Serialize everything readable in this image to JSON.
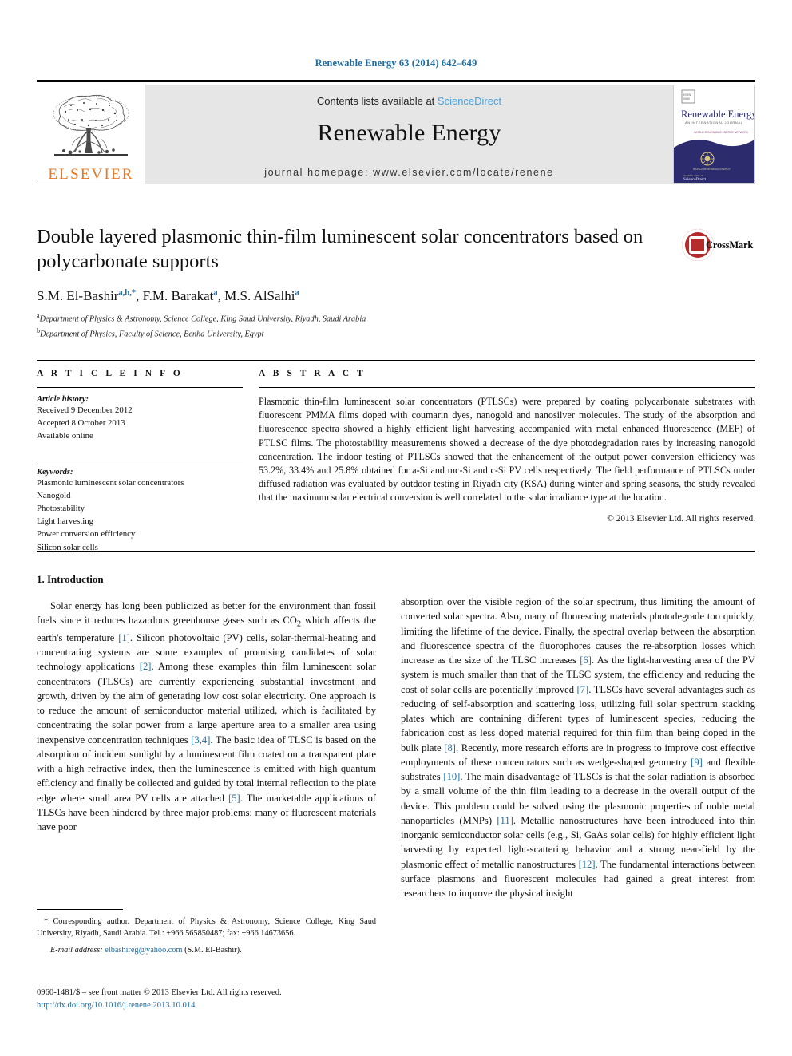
{
  "running_head": "Renewable Energy 63 (2014) 642–649",
  "masthead": {
    "contents_prefix": "Contents lists available at ",
    "sciencedirect": "ScienceDirect",
    "journal_title": "Renewable Energy",
    "homepage": "journal homepage: www.elsevier.com/locate/renene",
    "publisher_name": "ELSEVIER",
    "cover": {
      "title": "Renewable Energy",
      "subtitle": "AN INTERNATIONAL JOURNAL",
      "footer": "Elsevier"
    }
  },
  "article": {
    "title": "Double layered plasmonic thin-film luminescent solar concentrators based on polycarbonate supports",
    "authors": [
      {
        "name": "S.M. El-Bashir",
        "marks": "a,b,*"
      },
      {
        "name": "F.M. Barakat",
        "marks": "a"
      },
      {
        "name": "M.S. AlSalhi",
        "marks": "a"
      }
    ],
    "affiliations": [
      {
        "mark": "a",
        "text": "Department of Physics & Astronomy, Science College, King Saud University, Riyadh, Saudi Arabia"
      },
      {
        "mark": "b",
        "text": "Department of Physics, Faculty of Science, Benha University, Egypt"
      }
    ],
    "crossmark_label": "CrossMark"
  },
  "info": {
    "heading": "A R T I C L E   I N F O",
    "history_label": "Article history:",
    "history": [
      "Received 9 December 2012",
      "Accepted 8 October 2013",
      "Available online"
    ],
    "keywords_label": "Keywords:",
    "keywords": [
      "Plasmonic luminescent solar concentrators",
      "Nanogold",
      "Photostability",
      "Light harvesting",
      "Power conversion efficiency",
      "Silicon solar cells"
    ]
  },
  "abstract": {
    "heading": "A B S T R A C T",
    "text": "Plasmonic thin-film luminescent solar concentrators (PTLSCs) were prepared by coating polycarbonate substrates with fluorescent PMMA films doped with coumarin dyes, nanogold and nanosilver molecules. The study of the absorption and fluorescence spectra showed a highly efficient light harvesting accompanied with metal enhanced fluorescence (MEF) of PTLSC films. The photostability measurements showed a decrease of the dye photodegradation rates by increasing nanogold concentration. The indoor testing of PTLSCs showed that the enhancement of the output power conversion efficiency was 53.2%, 33.4% and 25.8% obtained for a-Si and mc-Si and c-Si PV cells respectively. The field performance of PTLSCs under diffused radiation was evaluated by outdoor testing in Riyadh city (KSA) during winter and spring seasons, the study revealed that the maximum solar electrical conversion is well correlated to the solar irradiance type at the location.",
    "copyright": "© 2013 Elsevier Ltd. All rights reserved."
  },
  "body": {
    "section_number_title": "1. Introduction",
    "left_paragraph_html": "Solar energy has long been publicized as better for the environment than fossil fuels since it reduces hazardous greenhouse gases such as CO<sub>2</sub> which affects the earth's temperature <span class=\"ref\">[1]</span>. Silicon photovoltaic (PV) cells, solar-thermal-heating and concentrating systems are some examples of promising candidates of solar technology applications <span class=\"ref\">[2]</span>. Among these examples thin film luminescent solar concentrators (TLSCs) are currently experiencing substantial investment and growth, driven by the aim of generating low cost solar electricity. One approach is to reduce the amount of semiconductor material utilized, which is facilitated by concentrating the solar power from a large aperture area to a smaller area using inexpensive concentration techniques <span class=\"ref\">[3,4]</span>. The basic idea of TLSC is based on the absorption of incident sunlight by a luminescent film coated on a transparent plate with a high refractive index, then the luminescence is emitted with high quantum efficiency and finally be collected and guided by total internal reflection to the plate edge where small area PV cells are attached <span class=\"ref\">[5]</span>. The marketable applications of TLSCs have been hindered by three major problems; many of fluorescent materials have poor",
    "right_paragraph_html": "absorption over the visible region of the solar spectrum, thus limiting the amount of converted solar spectra. Also, many of fluorescing materials photodegrade too quickly, limiting the lifetime of the device. Finally, the spectral overlap between the absorption and fluorescence spectra of the fluorophores causes the re-absorption losses which increase as the size of the TLSC increases <span class=\"ref\">[6]</span>. As the light-harvesting area of the PV system is much smaller than that of the TLSC system, the efficiency and reducing the cost of solar cells are potentially improved <span class=\"ref\">[7]</span>. TLSCs have several advantages such as reducing of self-absorption and scattering loss, utilizing full solar spectrum stacking plates which are containing different types of luminescent species, reducing the fabrication cost as less doped material required for thin film than being doped in the bulk plate <span class=\"ref\">[8]</span>. Recently, more research efforts are in progress to improve cost effective employments of these concentrators such as wedge-shaped geometry <span class=\"ref\">[9]</span> and flexible substrates <span class=\"ref\">[10]</span>. The main disadvantage of TLSCs is that the solar radiation is absorbed by a small volume of the thin film leading to a decrease in the overall output of the device. This problem could be solved using the plasmonic properties of noble metal nanoparticles (MNPs) <span class=\"ref\">[11]</span>. Metallic nanostructures have been introduced into thin inorganic semiconductor solar cells (e.g., Si, GaAs solar cells) for highly efficient light harvesting by expected light-scattering behavior and a strong near-field by the plasmonic effect of metallic nanostructures <span class=\"ref\">[12]</span>. The fundamental interactions between surface plasmons and fluorescent molecules had gained a great interest from researchers to improve the physical insight"
  },
  "footnote": {
    "text": "* Corresponding author. Department of Physics & Astronomy, Science College, King Saud University, Riyadh, Saudi Arabia. Tel.: +966 565850487; fax: +966 14673656.",
    "email_label": "E-mail address:",
    "email": "elbashireg@yahoo.com",
    "email_owner": "(S.M. El-Bashir)."
  },
  "footer": {
    "issn_line": "0960-1481/$ – see front matter © 2013 Elsevier Ltd. All rights reserved.",
    "doi": "http://dx.doi.org/10.1016/j.renene.2013.10.014"
  },
  "colors": {
    "link_blue": "#1c6ea4",
    "sciencedirect_blue": "#4aa3df",
    "elsevier_orange": "#e87722",
    "crossmark_red": "#b32b2b",
    "banner_gray": "#e6e6e6"
  }
}
